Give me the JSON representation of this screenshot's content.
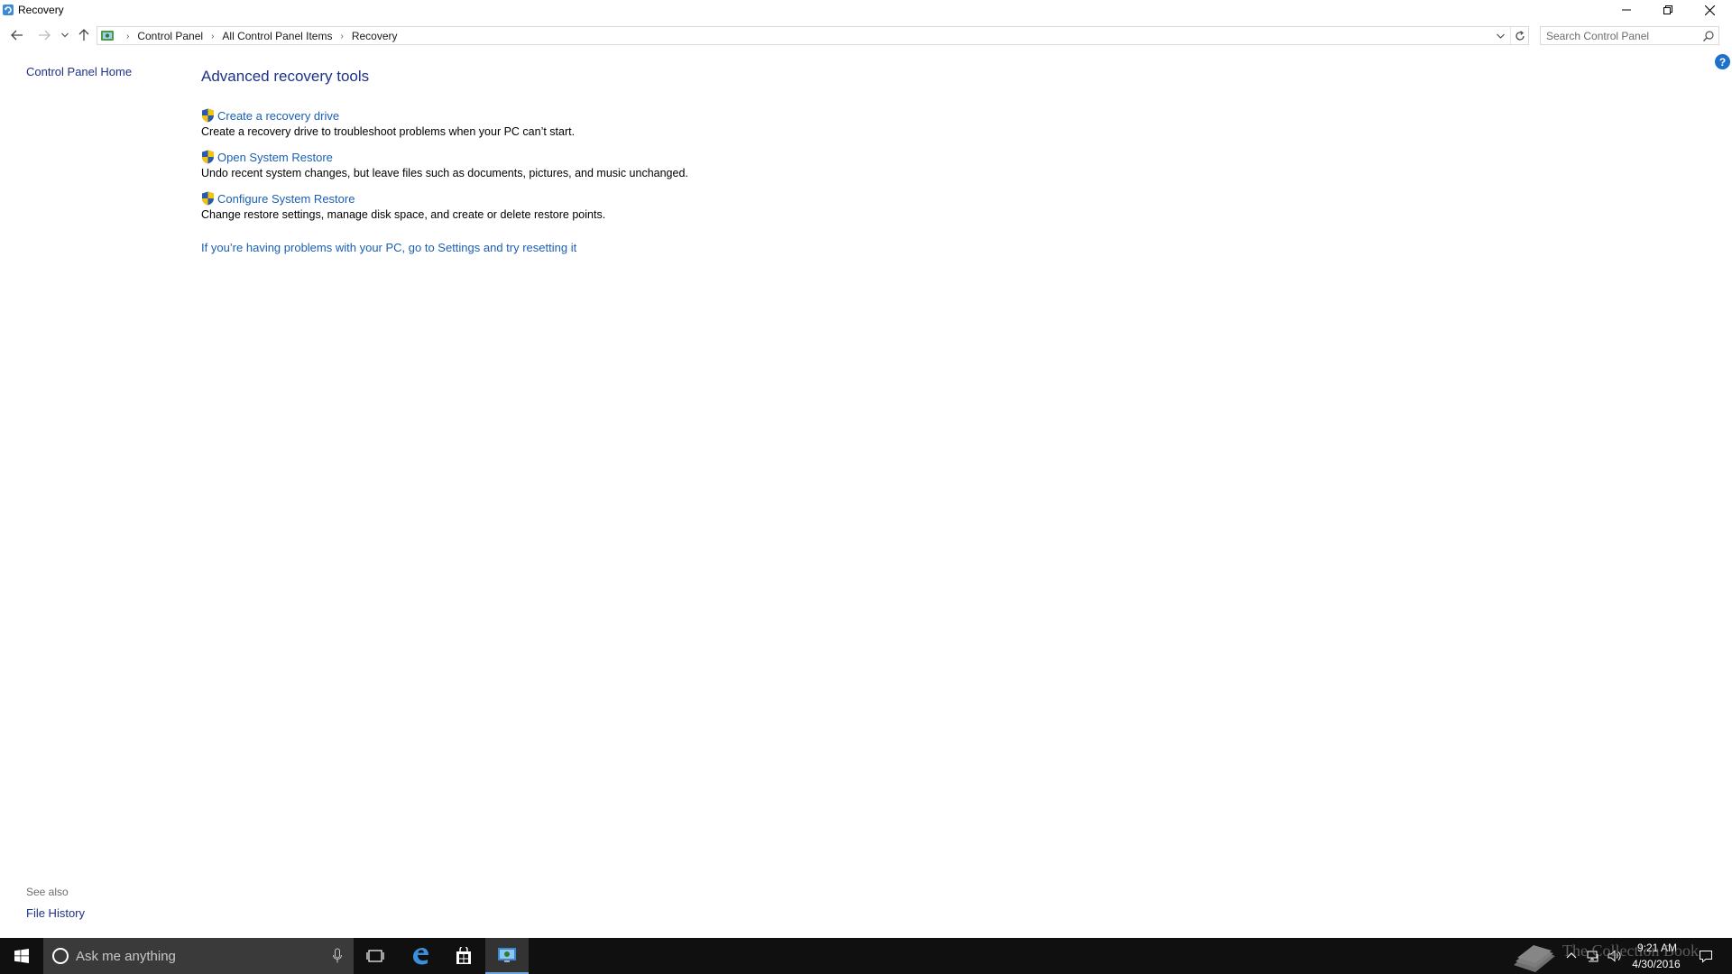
{
  "window": {
    "title": "Recovery"
  },
  "address": {
    "crumbs": [
      "Control Panel",
      "All Control Panel Items",
      "Recovery"
    ],
    "search_placeholder": "Search Control Panel"
  },
  "left_pane": {
    "home_label": "Control Panel Home",
    "see_also_label": "See also",
    "file_history_label": "File History"
  },
  "main": {
    "title": "Advanced recovery tools",
    "tools": [
      {
        "label": "Create a recovery drive",
        "description": "Create a recovery drive to troubleshoot problems when your PC can’t start."
      },
      {
        "label": "Open System Restore",
        "description": "Undo recent system changes, but leave files such as documents, pictures, and music unchanged."
      },
      {
        "label": "Configure System Restore",
        "description": "Change restore settings, manage disk space, and create or delete restore points."
      }
    ],
    "reset_link": "If you’re having problems with your PC, go to Settings and try resetting it"
  },
  "taskbar": {
    "search_placeholder": "Ask me anything",
    "time": "9:21 AM",
    "date": "4/30/2016",
    "icons": [
      "windows-start-icon",
      "cortana-icon",
      "microphone-icon",
      "task-view-icon",
      "edge-icon",
      "store-icon",
      "control-panel-icon"
    ]
  },
  "watermark": {
    "text": "The Collection Book"
  },
  "colors": {
    "link": "#1a5fb4",
    "heading": "#1e3287",
    "taskbar": "#101010",
    "search_box": "#3a3a3a"
  }
}
